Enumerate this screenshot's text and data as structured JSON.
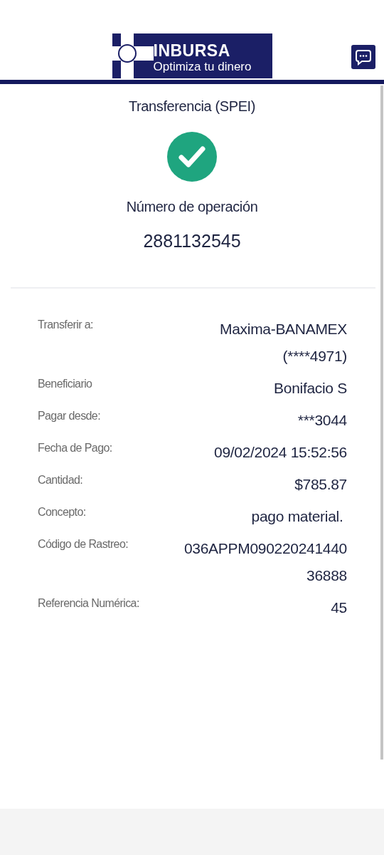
{
  "header": {
    "brand": "INBURSA",
    "tagline": "Optimiza tu dinero"
  },
  "summary": {
    "title": "Transferencia (SPEI)",
    "success": true,
    "operation_label": "Número de operación",
    "operation_number": "2881132545"
  },
  "details": [
    {
      "label": "Transferir a:",
      "value_lines": [
        "Maxima-BANAMEX",
        "(****4971)"
      ]
    },
    {
      "label": "Beneficiario",
      "value_lines": [
        "Bonifacio S"
      ]
    },
    {
      "label": "Pagar desde:",
      "value_lines": [
        "***3044"
      ]
    },
    {
      "label": "Fecha de Pago:",
      "value_lines": [
        "09/02/2024 15:52:56"
      ]
    },
    {
      "label": "Cantidad:",
      "value_lines": [
        "$785.87"
      ]
    },
    {
      "label": "Concepto:",
      "value_lines": [
        "pago material. "
      ]
    },
    {
      "label": "Código de Rastreo:",
      "value_lines": [
        "036APPM090220241440",
        "36888"
      ]
    },
    {
      "label": "Referencia Numérica:",
      "value_lines": [
        "45"
      ]
    }
  ]
}
